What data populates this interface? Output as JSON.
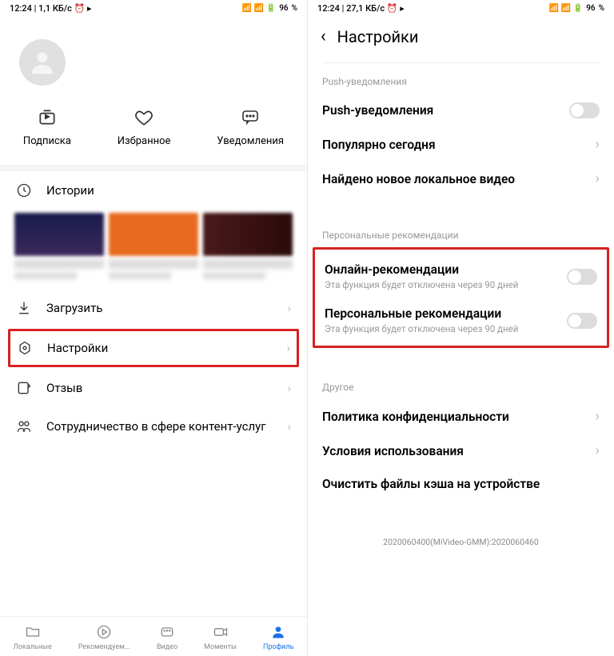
{
  "status": {
    "left_time": "12:24",
    "left_net1": "1,1 КБ/с",
    "left_net2": "27,1 КБ/с",
    "battery": "96",
    "battery_suffix": "%"
  },
  "left": {
    "trio": {
      "sub": "Подписка",
      "fav": "Избранное",
      "notif": "Уведомления"
    },
    "history": "Истории",
    "download": "Загрузить",
    "settings": "Настройки",
    "feedback": "Отзыв",
    "coop": "Сотрудничество в сфере контент-услуг",
    "nav": {
      "local": "Локальные",
      "rec": "Рекомендуем...",
      "video": "Видео",
      "moments": "Моменты",
      "profile": "Профиль"
    }
  },
  "right": {
    "header": "Настройки",
    "s1": "Push-уведомления",
    "push": "Push-уведомления",
    "popular": "Популярно сегодня",
    "found": "Найдено новое локальное видео",
    "s2": "Персональные рекомендации",
    "online_rec": "Онлайн-рекомендации",
    "online_sub": "Эта функция будет отключена через 90 дней",
    "pers_rec": "Персональные рекомендации",
    "pers_sub": "Эта функция будет отключена через 90 дней",
    "s3": "Другое",
    "privacy": "Политика конфиденциальности",
    "terms": "Условия использования",
    "cache": "Очистить файлы кэша на устройстве",
    "build": "2020060400(MiVideo-GMM):2020060460"
  }
}
